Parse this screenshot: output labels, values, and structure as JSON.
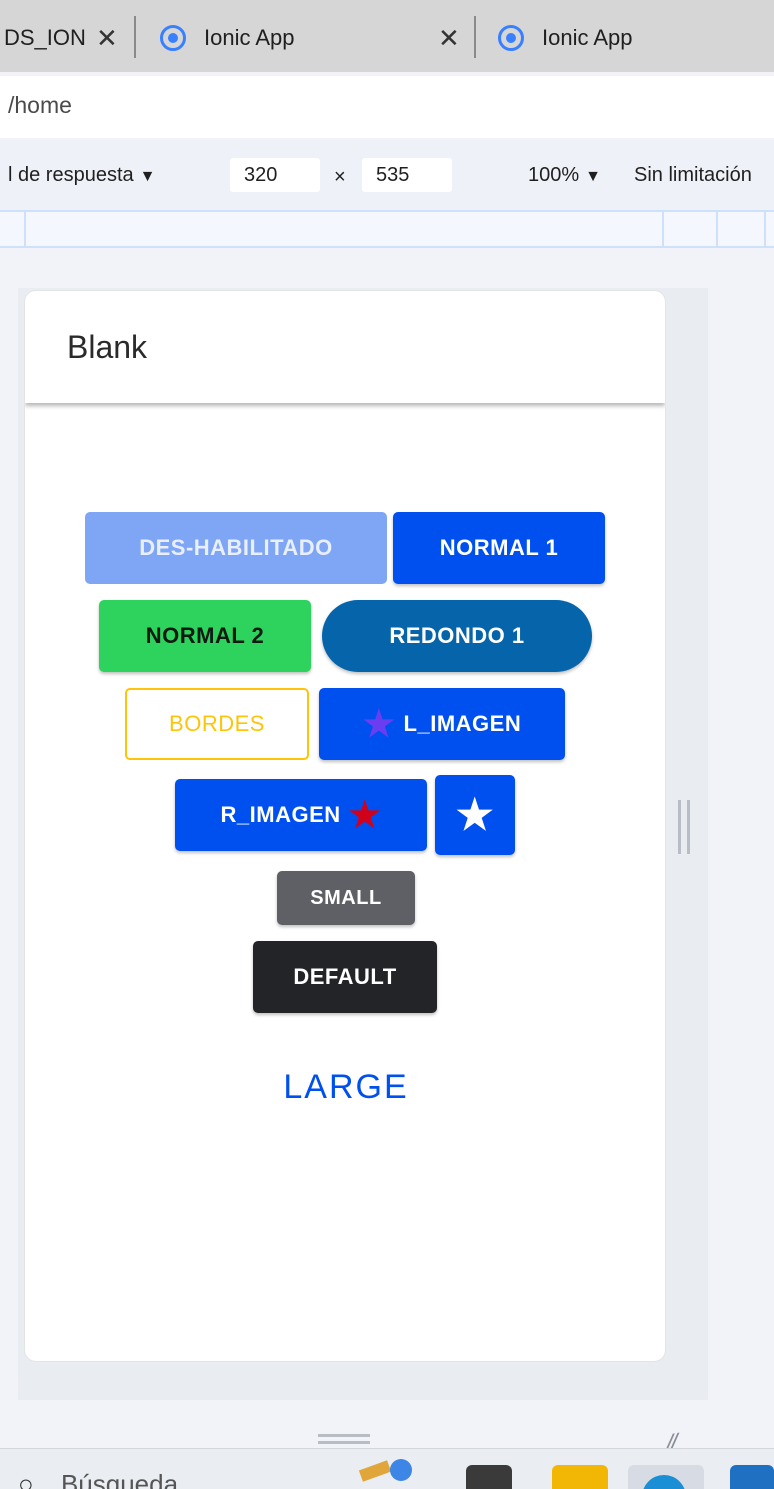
{
  "browser": {
    "tabs": [
      {
        "label": "DS_ION",
        "close": "✕"
      },
      {
        "label": "Ionic App",
        "close": "✕"
      },
      {
        "label": "Ionic App"
      }
    ],
    "address": "/home",
    "device_toolbar": {
      "mode": "l de respuesta",
      "width": "320",
      "times": "×",
      "height": "535",
      "zoom": "100%",
      "throttle": "Sin limitación"
    }
  },
  "app": {
    "title": "Blank",
    "buttons": {
      "disabled": "DES-HABILITADO",
      "normal1": "NORMAL 1",
      "normal2": "NORMAL 2",
      "round1": "REDONDO 1",
      "outline": "BORDES",
      "left_image": "L_IMAGEN",
      "right_image": "R_IMAGEN",
      "small": "SMALL",
      "default": "DEFAULT",
      "large": "LARGE"
    },
    "icons": {
      "star": "★"
    }
  },
  "taskbar": {
    "search_label": "Búsqueda"
  },
  "colors": {
    "primary": "#0050f0",
    "primary_disabled": "#7fa6f4",
    "success": "#2dd35c",
    "tertiary": "#0564aa",
    "warning": "#ffc409",
    "medium": "#5f6066",
    "dark": "#222428",
    "star_purple": "#6a3df0",
    "star_red": "#d0021b"
  }
}
